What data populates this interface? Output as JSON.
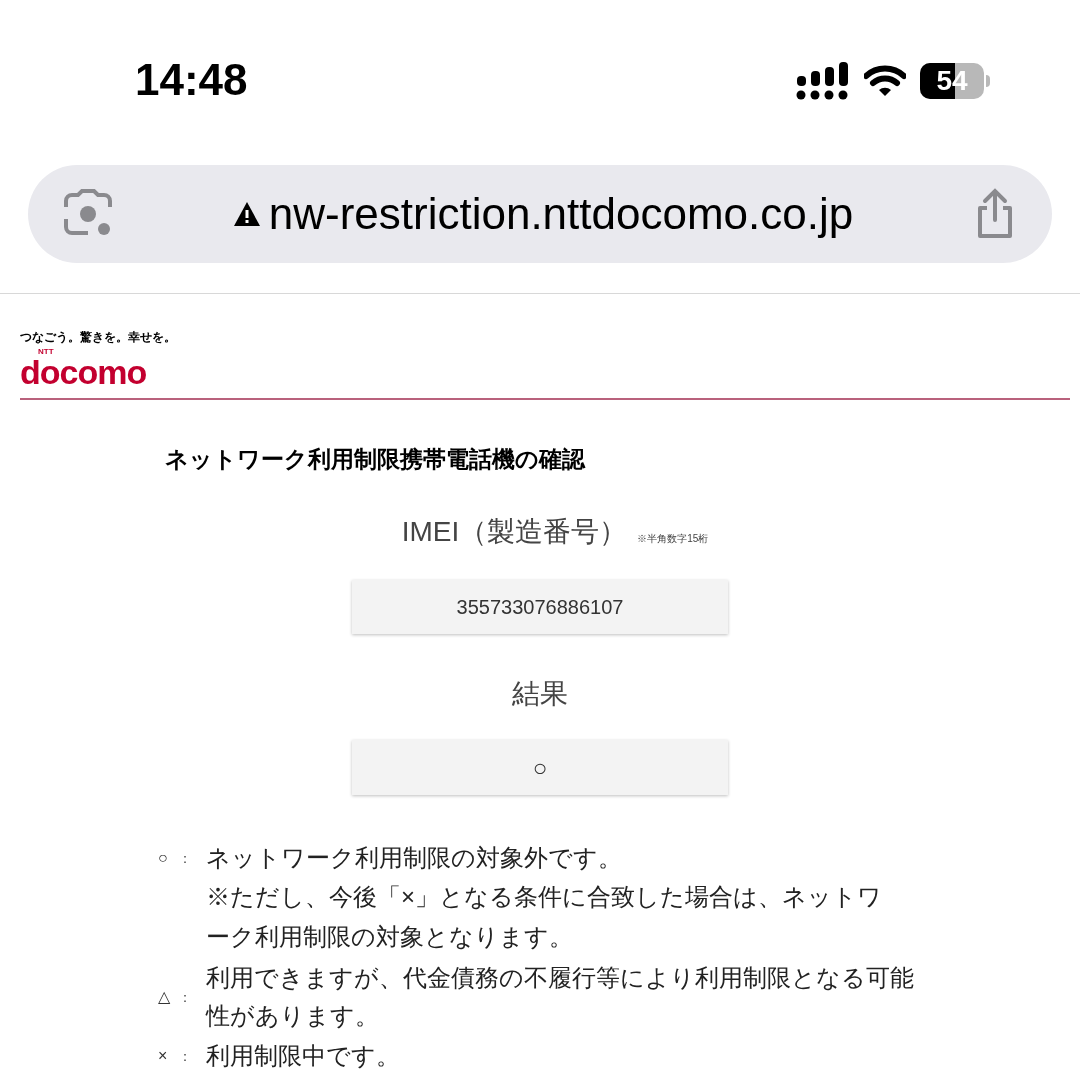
{
  "status_bar": {
    "time": "14:48",
    "battery": "54"
  },
  "address_bar": {
    "url": "nw-restriction.nttdocomo.co.jp",
    "insecure": true
  },
  "header": {
    "slogan": "つなごう。驚きを。幸せを。",
    "logo_small": "NTT",
    "logo": "docomo"
  },
  "title": "ネットワーク利用制限携帯電話機の確認",
  "imei": {
    "label": "IMEI（製造番号）",
    "note": "※半角数字15桁",
    "value": "355733076886107"
  },
  "result": {
    "label": "結果",
    "value": "○"
  },
  "legend": [
    {
      "symbol": "○",
      "separator": "：",
      "text": "ネットワーク利用制限の対象外です。",
      "note": "※ただし、今後「×」となる条件に合致した場合は、ネットワーク利用制限の対象となります。"
    },
    {
      "symbol": "△",
      "separator": "：",
      "text": "利用できますが、代金債務の不履行等により利用制限となる可能性があります。"
    },
    {
      "symbol": "×",
      "separator": "：",
      "text": "利用制限中です。"
    }
  ]
}
